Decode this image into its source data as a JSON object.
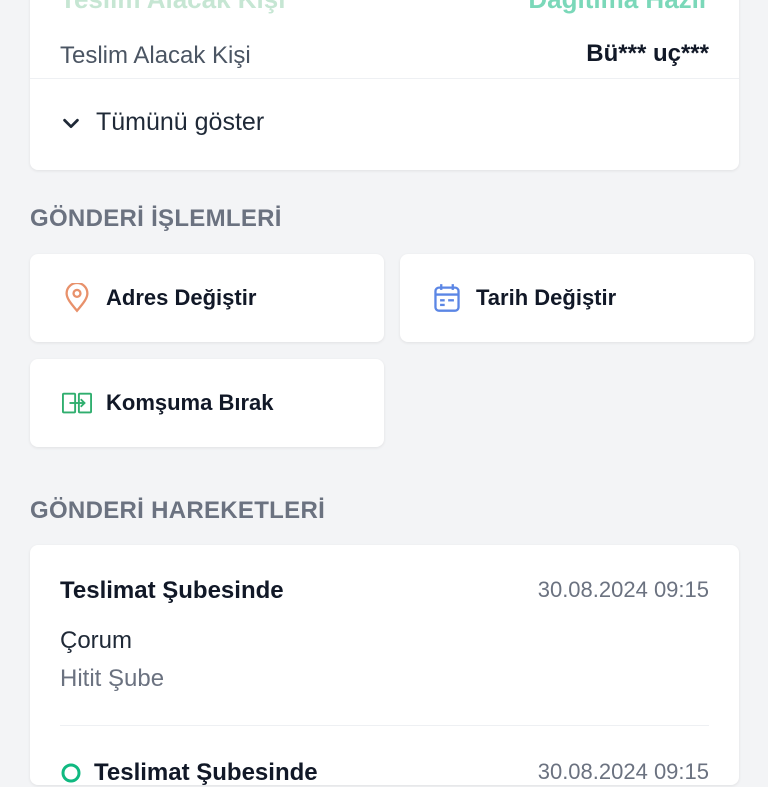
{
  "info": {
    "top_left_cut": "Teslim Alacak Kişi",
    "top_right_cut": "Dağıtıma Hazır",
    "recipient_label": "Teslim Alacak Kişi",
    "recipient_value": "Bü*** uç***",
    "show_all_label": "Tümünü göster"
  },
  "operations": {
    "title": "GÖNDERİ İŞLEMLERİ",
    "actions": [
      {
        "label": "Adres Değiştir",
        "icon": "map-pin-icon",
        "color": "#e8916b"
      },
      {
        "label": "Tarih Değiştir",
        "icon": "calendar-icon",
        "color": "#5b86e5"
      },
      {
        "label": "Komşuma Bırak",
        "icon": "transfer-box-icon",
        "color": "#2fae6e"
      }
    ]
  },
  "movements": {
    "title": "GÖNDERİ HAREKETLERİ",
    "items": [
      {
        "title": "Teslimat Şubesinde",
        "date": "30.08.2024 09:15",
        "city": "Çorum",
        "branch": "Hitit Şube"
      },
      {
        "title": "Teslimat Şubesinde",
        "date": "30.08.2024 09:15"
      }
    ]
  },
  "colors": {
    "background": "#f3f4f6",
    "card": "#ffffff",
    "accent_green": "#10b981"
  }
}
